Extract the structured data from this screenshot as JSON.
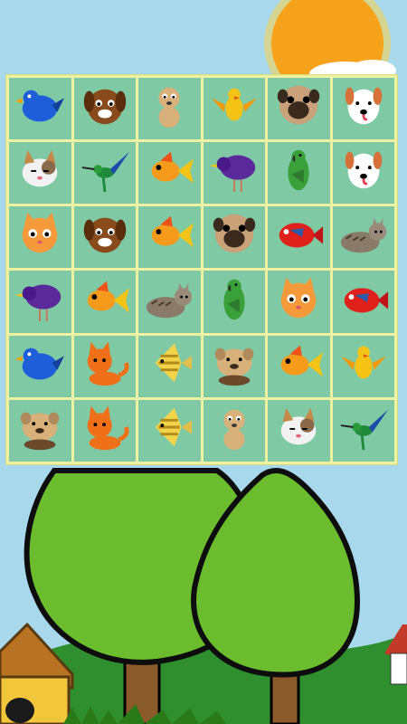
{
  "board": {
    "rows": [
      [
        {
          "icon": "blue-bird-icon"
        },
        {
          "icon": "brown-dog-icon"
        },
        {
          "icon": "tan-puppy-icon"
        },
        {
          "icon": "yellow-bird-icon"
        },
        {
          "icon": "pug-icon"
        },
        {
          "icon": "white-dog-icon"
        }
      ],
      [
        {
          "icon": "calico-cat-icon"
        },
        {
          "icon": "hummingbird-icon"
        },
        {
          "icon": "goldfish-icon"
        },
        {
          "icon": "purple-bird-icon"
        },
        {
          "icon": "green-parrot-icon"
        },
        {
          "icon": "white-dog-icon"
        }
      ],
      [
        {
          "icon": "orange-cat-icon"
        },
        {
          "icon": "brown-dog-icon"
        },
        {
          "icon": "goldfish-icon"
        },
        {
          "icon": "pug-icon"
        },
        {
          "icon": "red-fish-icon"
        },
        {
          "icon": "tabby-cat-icon"
        }
      ],
      [
        {
          "icon": "purple-bird-icon"
        },
        {
          "icon": "goldfish-icon"
        },
        {
          "icon": "tabby-cat-icon"
        },
        {
          "icon": "green-parrot-icon"
        },
        {
          "icon": "orange-cat-icon"
        },
        {
          "icon": "red-fish-icon"
        }
      ],
      [
        {
          "icon": "blue-bird-icon"
        },
        {
          "icon": "orange-kitten-icon"
        },
        {
          "icon": "angelfish-icon"
        },
        {
          "icon": "bulldog-icon"
        },
        {
          "icon": "goldfish-icon"
        },
        {
          "icon": "yellow-bird-icon"
        }
      ],
      [
        {
          "icon": "bulldog-icon"
        },
        {
          "icon": "orange-kitten-icon"
        },
        {
          "icon": "angelfish-icon"
        },
        {
          "icon": "tan-puppy-icon"
        },
        {
          "icon": "calico-cat-icon"
        },
        {
          "icon": "hummingbird-icon"
        }
      ]
    ]
  },
  "colors": {
    "sky": "#a8d8ec",
    "board_border": "#eef2a2",
    "tile": "#7fc9a5",
    "tree": "#6cbd2e",
    "tree_outline": "#0d0d0d",
    "hill": "#2f8f2f",
    "sun": "#f7a21b",
    "house": "#f2c63b",
    "roof": "#b77322"
  }
}
